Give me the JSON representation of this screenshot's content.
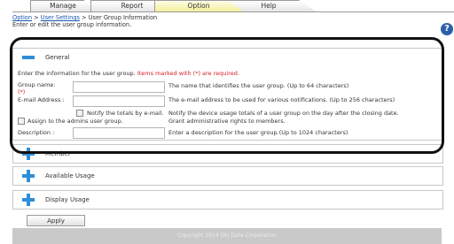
{
  "tabs": [
    {
      "label": "Manage",
      "active": false
    },
    {
      "label": "Report",
      "active": false
    },
    {
      "label": "Option",
      "active": true
    },
    {
      "label": "Help",
      "active": false
    }
  ],
  "breadcrumb": {
    "item1": "Option",
    "sep1": ">",
    "item2": "User Settings",
    "sep2": ">",
    "current": "User Group Information"
  },
  "instructions": "Enter or edit the user group information.",
  "help_icon": {
    "symbol": "?",
    "icon": "help-icon"
  },
  "general": {
    "title": "General",
    "info": "Enter the information for the user group.",
    "required_note": "Items marked with (*) are required.",
    "group_name_label": "Group name:",
    "required_mark": "(*)",
    "group_name_value": "",
    "group_name_desc": "The name that identifies the user group. (Up to 64 characters)",
    "email_label": "E-mail Address :",
    "email_value": "",
    "email_desc": "The e-mail address to be used for various notifications. (Up to 256 characters)",
    "notify_label": "Notify the totals by e-mail.",
    "notify_desc": "Notify the device usage totals of a user group on the day after the closing date.",
    "admin_label": "Assign to the admins user group.",
    "admin_desc": "Grant administrative rights to members.",
    "description_label": "Description :",
    "description_value": "",
    "description_desc": "Enter a description for the user group.(Up to 1024 characters)"
  },
  "sections": {
    "member": "Member",
    "available_usage": "Available Usage",
    "display_usage": "Display Usage"
  },
  "apply_label": "Apply",
  "footer": "Copyright 2014 Oki Data Corporation",
  "colors": {
    "accent_blue": "#2e8ed8",
    "required_red": "#d21f1f",
    "active_tab": "#f3ee9a",
    "footer_bg": "#c9c9c9"
  }
}
